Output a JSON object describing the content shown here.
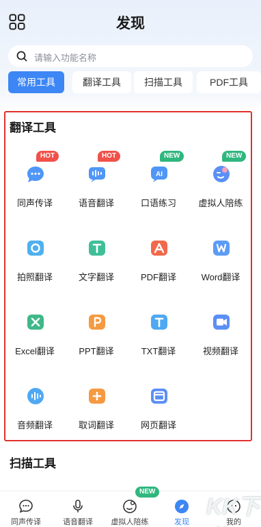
{
  "header": {
    "title": "发现"
  },
  "search": {
    "placeholder": "请输入功能名称"
  },
  "tabs": [
    {
      "label": "常用工具",
      "active": true
    },
    {
      "label": "翻译工具",
      "active": false
    },
    {
      "label": "扫描工具",
      "active": false
    },
    {
      "label": "PDF工具",
      "active": false
    }
  ],
  "translate_section": {
    "title": "翻译工具",
    "items": [
      {
        "label": "同声传译",
        "icon": "chat-bubble-icon",
        "badge": "HOT"
      },
      {
        "label": "语音翻译",
        "icon": "voice-wave-icon",
        "badge": "HOT"
      },
      {
        "label": "口语练习",
        "icon": "ai-chat-icon",
        "badge": "NEW"
      },
      {
        "label": "虚拟人陪练",
        "icon": "virtual-person-icon",
        "badge": "NEW"
      },
      {
        "label": "拍照翻译",
        "icon": "camera-icon",
        "badge": ""
      },
      {
        "label": "文字翻译",
        "icon": "text-t-icon",
        "badge": ""
      },
      {
        "label": "PDF翻译",
        "icon": "pdf-icon",
        "badge": ""
      },
      {
        "label": "Word翻译",
        "icon": "word-icon",
        "badge": ""
      },
      {
        "label": "Excel翻译",
        "icon": "excel-icon",
        "badge": ""
      },
      {
        "label": "PPT翻译",
        "icon": "ppt-icon",
        "badge": ""
      },
      {
        "label": "TXT翻译",
        "icon": "txt-icon",
        "badge": ""
      },
      {
        "label": "视频翻译",
        "icon": "video-icon",
        "badge": ""
      },
      {
        "label": "音频翻译",
        "icon": "audio-icon",
        "badge": ""
      },
      {
        "label": "取词翻译",
        "icon": "word-pick-icon",
        "badge": ""
      },
      {
        "label": "网页翻译",
        "icon": "webpage-icon",
        "badge": ""
      }
    ]
  },
  "scan_section": {
    "title": "扫描工具"
  },
  "bottom_nav": {
    "items": [
      {
        "label": "同声传译",
        "icon": "chat-bubble-icon"
      },
      {
        "label": "语音翻译",
        "icon": "microphone-icon"
      },
      {
        "label": "虚拟人陪练",
        "icon": "virtual-person-icon"
      },
      {
        "label": "发现",
        "icon": "discover-icon",
        "active": true
      },
      {
        "label": "我的",
        "icon": "profile-icon"
      }
    ],
    "badge": "NEW"
  },
  "watermark": "KK下载",
  "colors": {
    "accent": "#3d86f5",
    "hot": "#f0514a",
    "new": "#2fb77e",
    "frame": "#e0312b"
  }
}
